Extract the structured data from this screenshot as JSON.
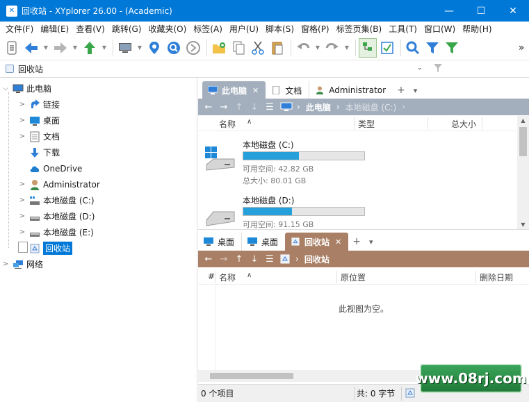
{
  "window": {
    "title": "回收站 - XYplorer 26.00 - (Academic)",
    "app_icon_glyph": "✕",
    "controls": {
      "minimize": "—",
      "maximize": "☐",
      "close": "✕"
    }
  },
  "menu": [
    "文件(F)",
    "编辑(E)",
    "查看(V)",
    "跳转(G)",
    "收藏夹(O)",
    "标签(A)",
    "用户(U)",
    "脚本(S)",
    "窗格(P)",
    "标签页集(B)",
    "工具(T)",
    "窗口(W)",
    "帮助(H)"
  ],
  "toolbar": {
    "overflow": "»",
    "icons": [
      "hamburger-icon",
      "back-arrow-icon",
      "forward-arrow-icon",
      "up-arrow-icon",
      "computer-icon",
      "location-pin-icon",
      "find-files-icon",
      "go-circle-icon",
      "new-folder-icon",
      "copy-icon",
      "cut-icon",
      "paste-icon",
      "undo-icon",
      "redo-icon",
      "dual-pane-icon",
      "checkbox-icon",
      "search-icon",
      "filter-icon",
      "green-filter-icon"
    ]
  },
  "address": {
    "value": "回收站",
    "dropdown": "⌄"
  },
  "tree": {
    "items": [
      {
        "label": "此电脑",
        "icon": "computer-icon",
        "expander": "⌵"
      },
      {
        "label": "链接",
        "icon": "link-arrow-icon",
        "expander": ">"
      },
      {
        "label": "桌面",
        "icon": "desktop-icon",
        "expander": ">"
      },
      {
        "label": "文档",
        "icon": "document-icon",
        "expander": ">"
      },
      {
        "label": "下载",
        "icon": "download-icon",
        "expander": ""
      },
      {
        "label": "OneDrive",
        "icon": "cloud-icon",
        "expander": ""
      },
      {
        "label": "Administrator",
        "icon": "user-icon",
        "expander": ">"
      },
      {
        "label": "本地磁盘 (C:)",
        "icon": "drive-icon",
        "expander": ">"
      },
      {
        "label": "本地磁盘 (D:)",
        "icon": "drive-icon",
        "expander": ">"
      },
      {
        "label": "本地磁盘 (E:)",
        "icon": "drive-icon",
        "expander": ">"
      },
      {
        "label": "回收站",
        "icon": "recycle-bin-icon",
        "expander": ""
      },
      {
        "label": "网络",
        "icon": "network-icon",
        "expander": ">"
      }
    ]
  },
  "pane1": {
    "tabs": [
      {
        "label": "此电脑",
        "close": "✕"
      },
      {
        "label": "文档"
      },
      {
        "label": "Administrator"
      }
    ],
    "tab_plus": "+",
    "tab_menu": "▾",
    "nav": {
      "crumbs": [
        "此电脑",
        "本地磁盘 (C:)"
      ]
    },
    "columns": {
      "name": "名称",
      "type": "类型",
      "size": "总大小"
    },
    "drives": [
      {
        "name": "本地磁盘 (C:)",
        "free": "可用空间: 42.82 GB",
        "total": "总大小: 80.01 GB",
        "used_fraction": 0.46
      },
      {
        "name": "本地磁盘 (D:)",
        "free": "可用空间: 91.15 GB",
        "total": "",
        "used_fraction": 0.4
      }
    ]
  },
  "pane2": {
    "tabs": [
      {
        "label": "桌面"
      },
      {
        "label": "桌面"
      },
      {
        "label": "回收站",
        "close": "✕"
      }
    ],
    "tab_plus": "+",
    "tab_menu": "▾",
    "nav": {
      "crumbs": [
        "回收站"
      ]
    },
    "columns": {
      "num": "#",
      "name": "名称",
      "orig": "原位置",
      "deleted": "删除日期"
    },
    "empty_text": "此视图为空。"
  },
  "status": {
    "items": "0 个项目",
    "total": "共: 0 字节"
  },
  "watermark": "www.08rj.com",
  "colors": {
    "titlebar": "#0078d7",
    "pane1_tab": "#a3afbd",
    "pane2_tab": "#a97f65",
    "drive_bar": "#26a0da"
  }
}
